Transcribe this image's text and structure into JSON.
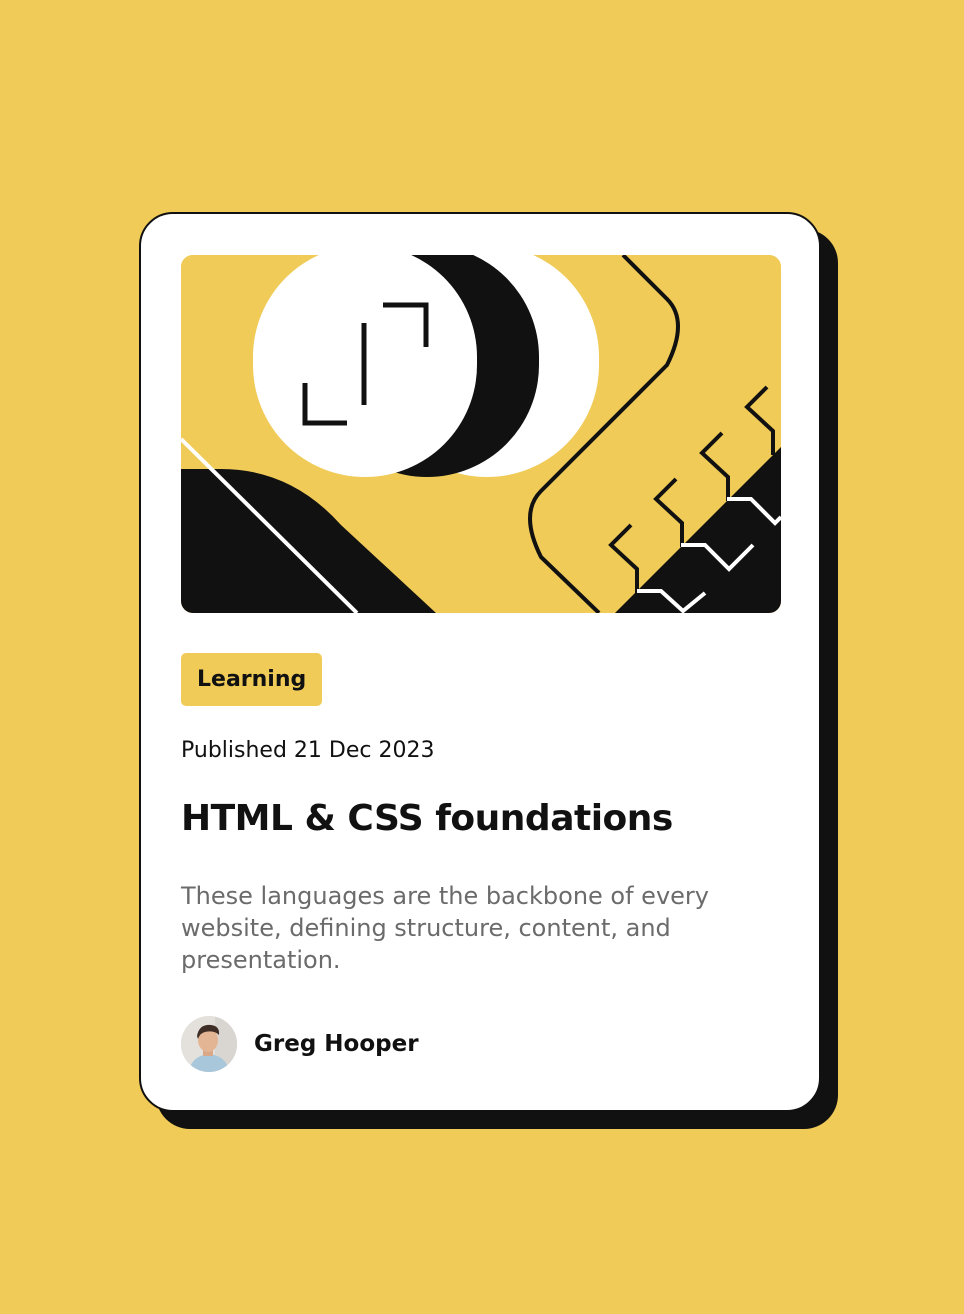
{
  "colors": {
    "background": "#F0CB57",
    "card": "#FFFFFF",
    "ink": "#111111",
    "muted_text": "#6B6B6B"
  },
  "card": {
    "tag": "Learning",
    "published": "Published 21 Dec 2023",
    "title": "HTML & CSS foundations",
    "description": "These languages are the backbone of every website, defining structure, content, and presentation.",
    "author": {
      "name": "Greg Hooper",
      "avatar": "author-avatar-photo"
    },
    "illustration": "abstract-geometric-illustration"
  }
}
